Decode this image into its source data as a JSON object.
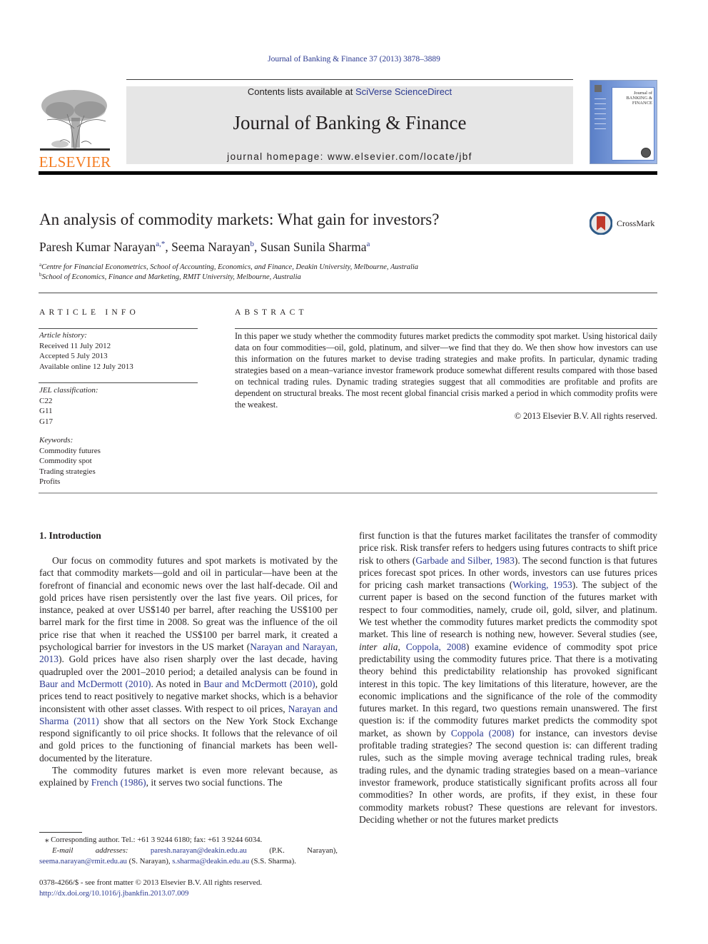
{
  "running_head": "Journal of Banking & Finance 37 (2013) 3878–3889",
  "masthead": {
    "publisher": "ELSEVIER",
    "contents_prefix": "Contents lists available at ",
    "contents_link": "SciVerse ScienceDirect",
    "journal_title": "Journal of Banking & Finance",
    "homepage": "journal homepage: www.elsevier.com/locate/jbf",
    "cover_title": "Journal of BANKING & FINANCE"
  },
  "crossmark_label": "CrossMark",
  "article": {
    "title": "An analysis of commodity markets: What gain for investors?",
    "authors": [
      {
        "name": "Paresh Kumar Narayan",
        "sup": "a,*",
        "sep": ", "
      },
      {
        "name": "Seema Narayan",
        "sup": "b",
        "sep": ", "
      },
      {
        "name": "Susan Sunila Sharma",
        "sup": "a",
        "sep": ""
      }
    ],
    "affiliations": [
      {
        "mark": "a",
        "text": "Centre for Financial Econometrics, School of Accounting, Economics, and Finance, Deakin University, Melbourne, Australia"
      },
      {
        "mark": "b",
        "text": "School of Economics, Finance and Marketing, RMIT University, Melbourne, Australia"
      }
    ]
  },
  "article_info": {
    "heading": "ARTICLE INFO",
    "history_label": "Article history:",
    "history": [
      "Received 11 July 2012",
      "Accepted 5 July 2013",
      "Available online 12 July 2013"
    ],
    "jel_label": "JEL classification:",
    "jel": [
      "C22",
      "G11",
      "G17"
    ],
    "keywords_label": "Keywords:",
    "keywords": [
      "Commodity futures",
      "Commodity spot",
      "Trading strategies",
      "Profits"
    ]
  },
  "abstract": {
    "heading": "ABSTRACT",
    "text": "In this paper we study whether the commodity futures market predicts the commodity spot market. Using historical daily data on four commodities—oil, gold, platinum, and silver—we find that they do. We then show how investors can use this information on the futures market to devise trading strategies and make profits. In particular, dynamic trading strategies based on a mean–variance investor framework produce somewhat different results compared with those based on technical trading rules. Dynamic trading strategies suggest that all commodities are profitable and profits are dependent on structural breaks. The most recent global financial crisis marked a period in which commodity profits were the weakest.",
    "copyright": "© 2013 Elsevier B.V. All rights reserved."
  },
  "introduction": {
    "heading": "1. Introduction",
    "left": {
      "p1": [
        {
          "t": "Our focus on commodity futures and spot markets is motivated by the fact that commodity markets—gold and oil in particular—have been at the forefront of financial and economic news over the last half-decade. Oil and gold prices have risen persistently over the last five years. Oil prices, for instance, peaked at over US$140 per barrel, after reaching the US$100 per barrel mark for the first time in 2008. So great was the influence of the oil price rise that when it reached the US$100 per barrel mark, it created a psychological barrier for investors in the US market ("
        },
        {
          "link": "Narayan and Narayan, 2013"
        },
        {
          "t": "). Gold prices have also risen sharply over the last decade, having quadrupled over the 2001–2010 period; a detailed analysis can be found in "
        },
        {
          "link": "Baur and McDermott (2010)"
        },
        {
          "t": ". As noted in "
        },
        {
          "link": "Baur and McDermott (2010)"
        },
        {
          "t": ", gold prices tend to react positively to negative market shocks, which is a behavior inconsistent with other asset classes. With respect to oil prices, "
        },
        {
          "link": "Narayan and Sharma (2011)"
        },
        {
          "t": " show that all sectors on the New York Stock Exchange respond significantly to oil price shocks. It follows that the relevance of oil and gold prices to the functioning of financial markets has been well-documented by the literature."
        }
      ],
      "p2": [
        {
          "t": "The commodity futures market is even more relevant because, as explained by "
        },
        {
          "link": "French (1986)"
        },
        {
          "t": ", it serves two social functions. The"
        }
      ]
    },
    "right": {
      "p1": [
        {
          "t": "first function is that the futures market facilitates the transfer of commodity price risk. Risk transfer refers to hedgers using futures contracts to shift price risk to others ("
        },
        {
          "link": "Garbade and Silber, 1983"
        },
        {
          "t": "). The second function is that futures prices forecast spot prices. In other words, investors can use futures prices for pricing cash market transactions ("
        },
        {
          "link": "Working, 1953"
        },
        {
          "t": "). The subject of the current paper is based on the second function of the futures market with respect to four commodities, namely, crude oil, gold, silver, and platinum. We test whether the commodity futures market predicts the commodity spot market. This line of research is nothing new, however. Several studies (see, "
        },
        {
          "i": "inter alia"
        },
        {
          "t": ", "
        },
        {
          "link": "Coppola, 2008"
        },
        {
          "t": ") examine evidence of commodity spot price predictability using the commodity futures price. That there is a motivating theory behind this predictability relationship has provoked significant interest in this topic. The key limitations of this literature, however, are the economic implications and the significance of the role of the commodity futures market. In this regard, two questions remain unanswered. The first question is: if the commodity futures market predicts the commodity spot market, as shown by "
        },
        {
          "link": "Coppola (2008)"
        },
        {
          "t": " for instance, can investors devise profitable trading strategies? The second question is: can different trading rules, such as the simple moving average technical trading rules, break trading rules, and the dynamic trading strategies based on a mean–variance investor framework, produce statistically significant profits across all four commodities? In other words, are profits, if they exist, in these four commodity markets robust? These questions are relevant for investors. Deciding whether or not the futures market predicts"
        }
      ]
    }
  },
  "footnote": {
    "star": "⁎",
    "corresponding": "Corresponding author. Tel.: +61 3 9244 6180; fax: +61 3 9244 6034.",
    "email_label": "E-mail addresses:",
    "emails": [
      {
        "addr": "paresh.narayan@deakin.edu.au",
        "who": " (P.K. Narayan), "
      },
      {
        "addr": "seema.narayan@rmit.edu.au",
        "who": " (S. Narayan), "
      },
      {
        "addr": "s.sharma@deakin.edu.au",
        "who": " (S.S. Sharma)."
      }
    ]
  },
  "front_matter": {
    "issn_line": "0378-4266/$ - see front matter © 2013 Elsevier B.V. All rights reserved.",
    "doi": "http://dx.doi.org/10.1016/j.jbankfin.2013.07.009"
  },
  "colors": {
    "link": "#2b3990",
    "elsevier_orange": "#f47b20",
    "masthead_bg": "#e6e6e6",
    "crossmark_red": "#c0392b"
  }
}
